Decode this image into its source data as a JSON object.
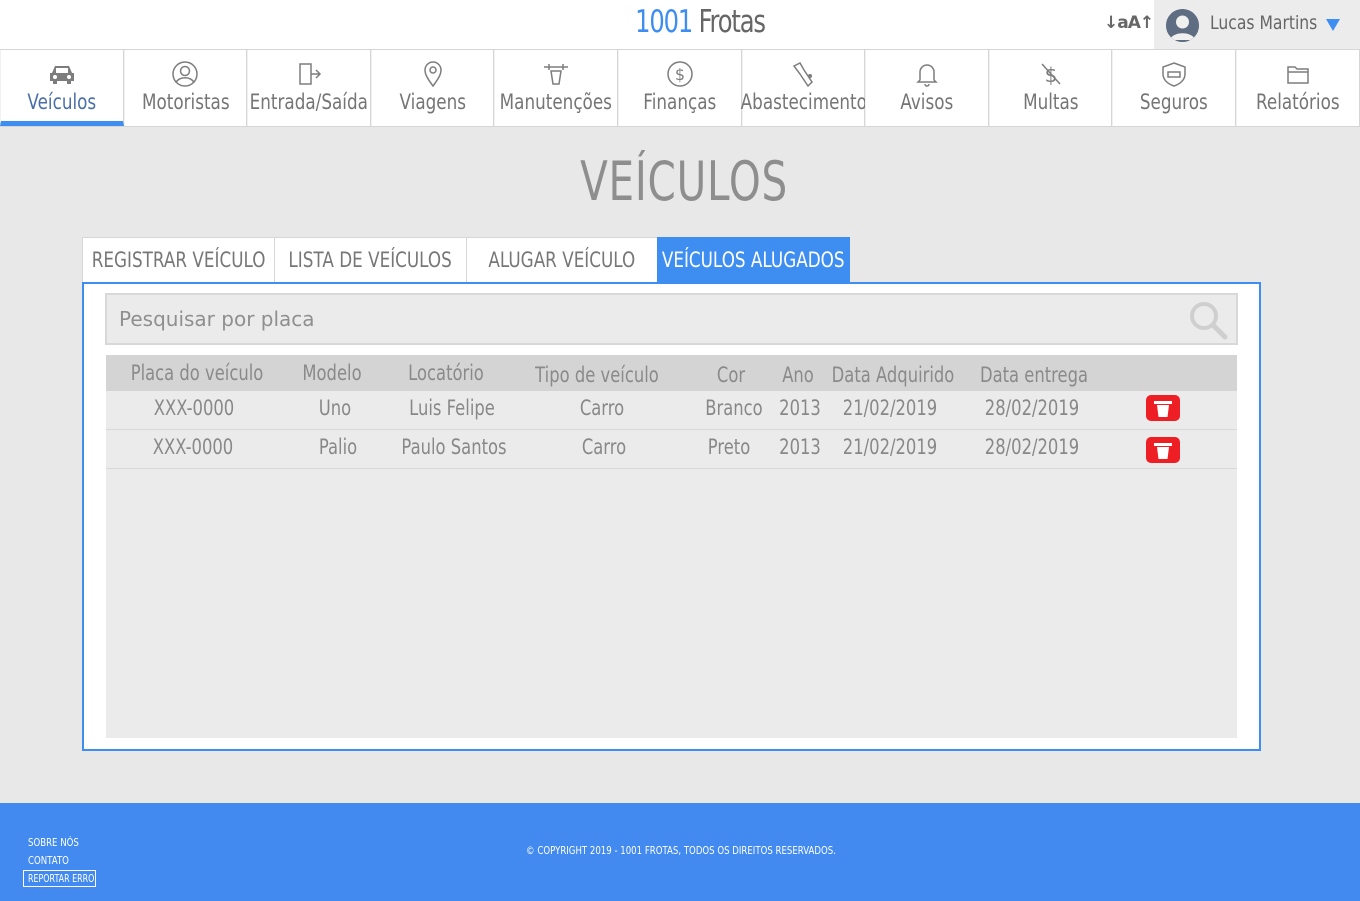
{
  "header": {
    "brand_number": "1001",
    "brand_name": "Frotas",
    "font_size_control": "↓aA↑",
    "user_name": "Lucas Martins"
  },
  "nav": {
    "items": [
      {
        "label": "Veículos",
        "icon": "car-icon",
        "active": true
      },
      {
        "label": "Motoristas",
        "icon": "driver-icon"
      },
      {
        "label": "Entrada/Saída",
        "icon": "door-icon"
      },
      {
        "label": "Viagens",
        "icon": "map-pin-icon"
      },
      {
        "label": "Manutenções",
        "icon": "wrench-icon"
      },
      {
        "label": "Finanças",
        "icon": "dollar-icon"
      },
      {
        "label": "Abastecimento",
        "icon": "fuel-icon"
      },
      {
        "label": "Avisos",
        "icon": "bell-icon"
      },
      {
        "label": "Multas",
        "icon": "fine-icon"
      },
      {
        "label": "Seguros",
        "icon": "insurance-icon"
      },
      {
        "label": "Relatórios",
        "icon": "folder-icon"
      }
    ]
  },
  "page": {
    "title": "VEÍCULOS"
  },
  "tabs": [
    {
      "label": "REGISTRAR VEÍCULO"
    },
    {
      "label": "LISTA DE VEÍCULOS"
    },
    {
      "label": "ALUGAR VEÍCULO"
    },
    {
      "label": "VEÍCULOS ALUGADOS",
      "active": true
    }
  ],
  "search": {
    "placeholder": "Pesquisar por placa",
    "value": ""
  },
  "table": {
    "columns": [
      "Placa do veículo",
      "Modelo",
      "Locatório",
      "Tipo de veículo",
      "Cor",
      "Ano",
      "Data Adquirido",
      "Data entrega"
    ],
    "rows": [
      [
        "XXX-0000",
        "Uno",
        "Luis Felipe",
        "Carro",
        "Branco",
        "2013",
        "21/02/2019",
        "28/02/2019"
      ],
      [
        "XXX-0000",
        "Palio",
        "Paulo Santos",
        "Carro",
        "Preto",
        "2013",
        "21/02/2019",
        "28/02/2019"
      ]
    ],
    "row_action_icon": "trash-icon"
  },
  "footer": {
    "about": "SOBRE NÓS",
    "contact": "CONTATO",
    "report": "REPORTAR ERRO",
    "copyright": "© COPYRIGHT 2019 - 1001 FROTAS, TODOS OS DIREITOS RESERVADOS."
  },
  "colors": {
    "accent": "#3d8ef0",
    "footer": "#428af0",
    "delete": "#ee1f24"
  }
}
